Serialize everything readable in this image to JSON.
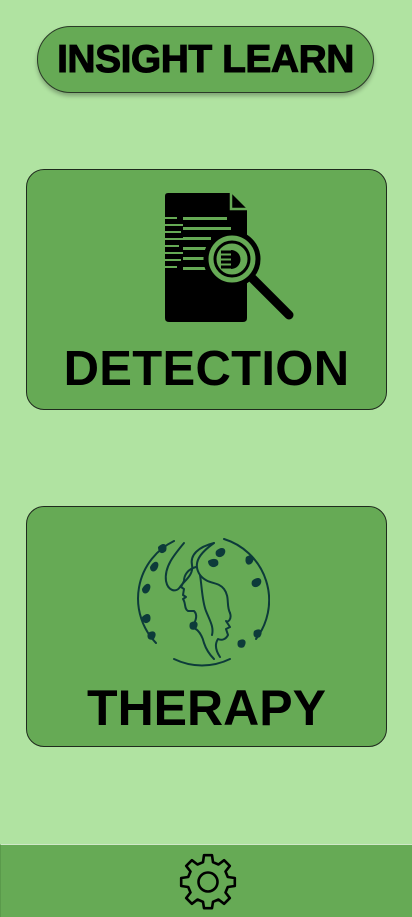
{
  "header": {
    "title": "INSIGHT LEARN"
  },
  "cards": {
    "detection": {
      "label": "DETECTION",
      "icon": "document-search-icon"
    },
    "therapy": {
      "label": "THERAPY",
      "icon": "mind-leaves-icon"
    }
  },
  "bottom_nav": {
    "settings_icon": "gear-icon"
  },
  "colors": {
    "background": "#b0e3a1",
    "accent": "#66aa55",
    "therapy_icon": "#0d3b3a"
  }
}
